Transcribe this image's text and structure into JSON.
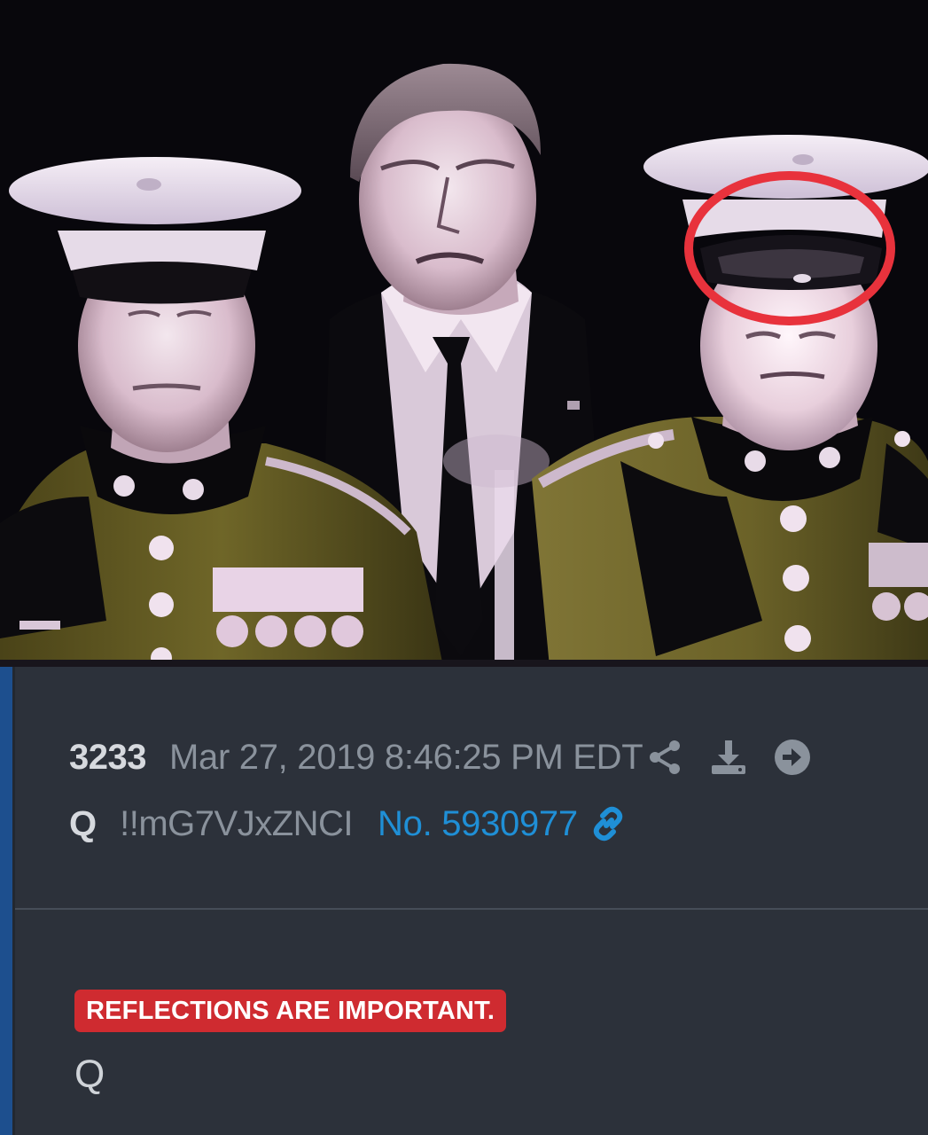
{
  "post": {
    "number": "3233",
    "date": "Mar 27, 2019 8:46:25 PM EDT",
    "author": "Q",
    "tripcode": "!!mG7VJxZNCI",
    "post_link": "No. 5930977",
    "headline": "REFLECTIONS ARE IMPORTANT.",
    "signature": "Q"
  },
  "icons": {
    "share": "share-icon",
    "download": "download-icon",
    "open": "arrow-right-circle-icon",
    "link": "link-icon"
  },
  "colors": {
    "card_background": "#2c313a",
    "accent_bar": "#1d4f8e",
    "link": "#1f8fd6",
    "headline_background": "#cf2b30",
    "annotation_circle": "#e8323c"
  }
}
